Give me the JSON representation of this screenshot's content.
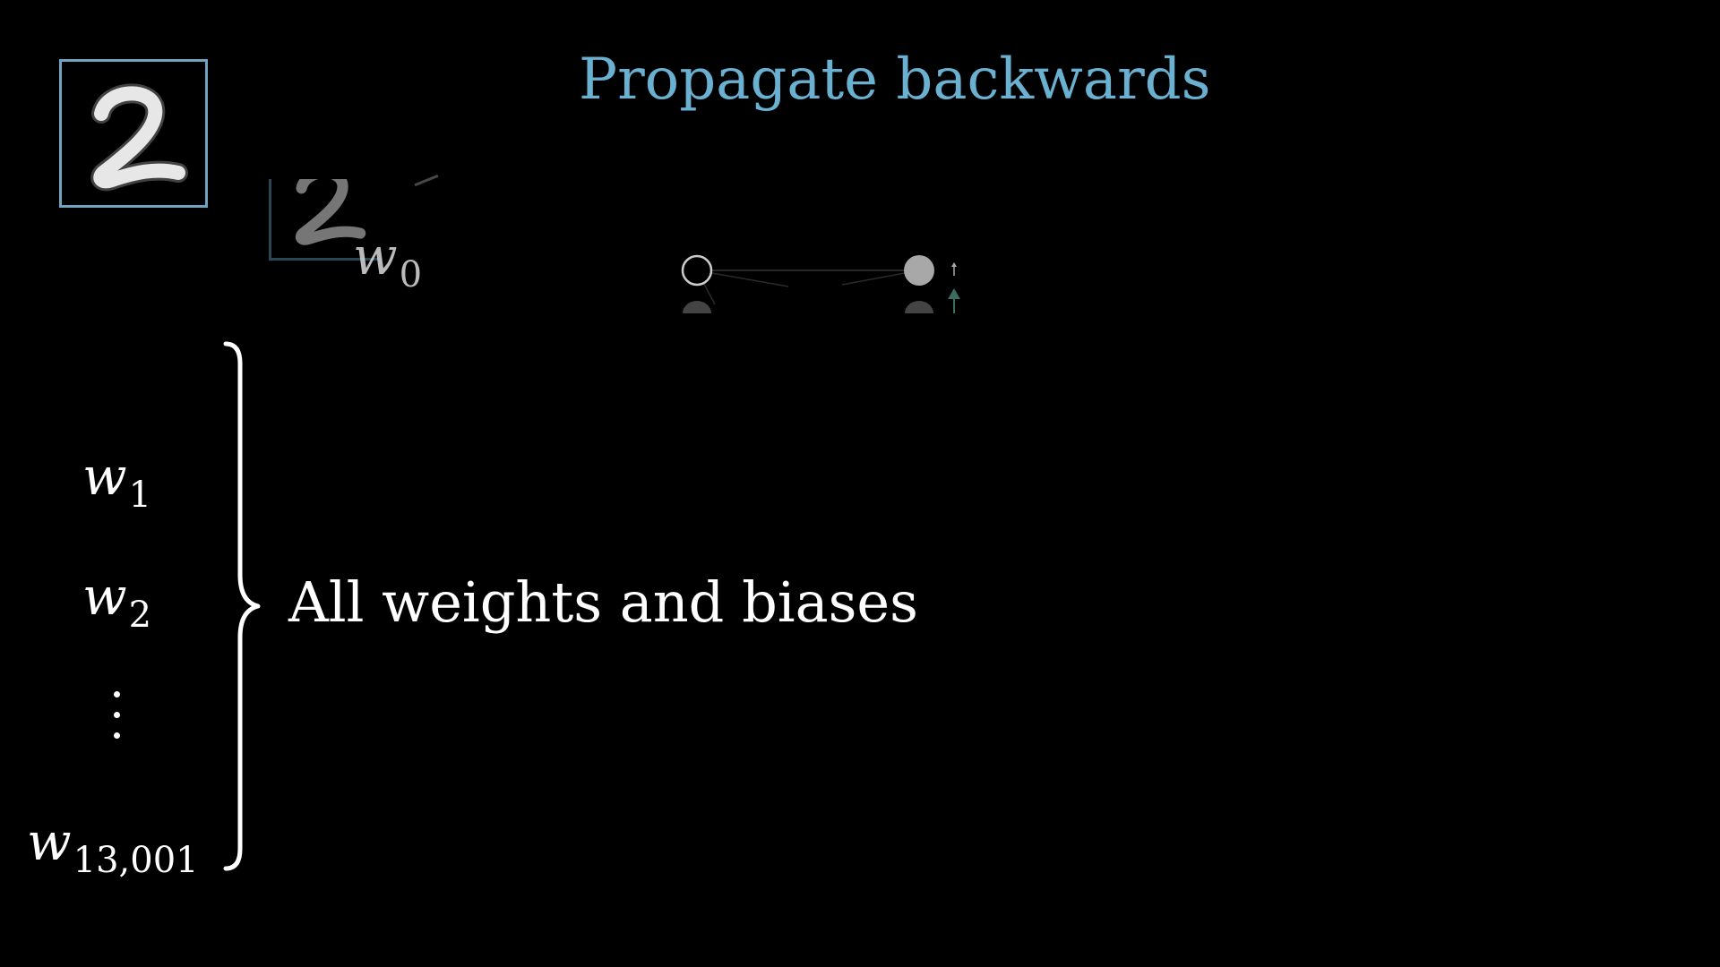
{
  "title": "Propagate backwards",
  "parameters": {
    "w0": {
      "base": "w",
      "sub": "0"
    },
    "w1": {
      "base": "w",
      "sub": "1"
    },
    "w2": {
      "base": "w",
      "sub": "2"
    },
    "w_last": {
      "base": "w",
      "sub": "13,001"
    }
  },
  "brace_label": "All weights and biases",
  "colors": {
    "title": "#6ab0d1",
    "frame": "#6fa3bf",
    "text": "#ffffff",
    "background": "#000000"
  },
  "icons": {
    "digit_image": "handwritten-digit-2",
    "ellipsis": "vertical-dots"
  }
}
